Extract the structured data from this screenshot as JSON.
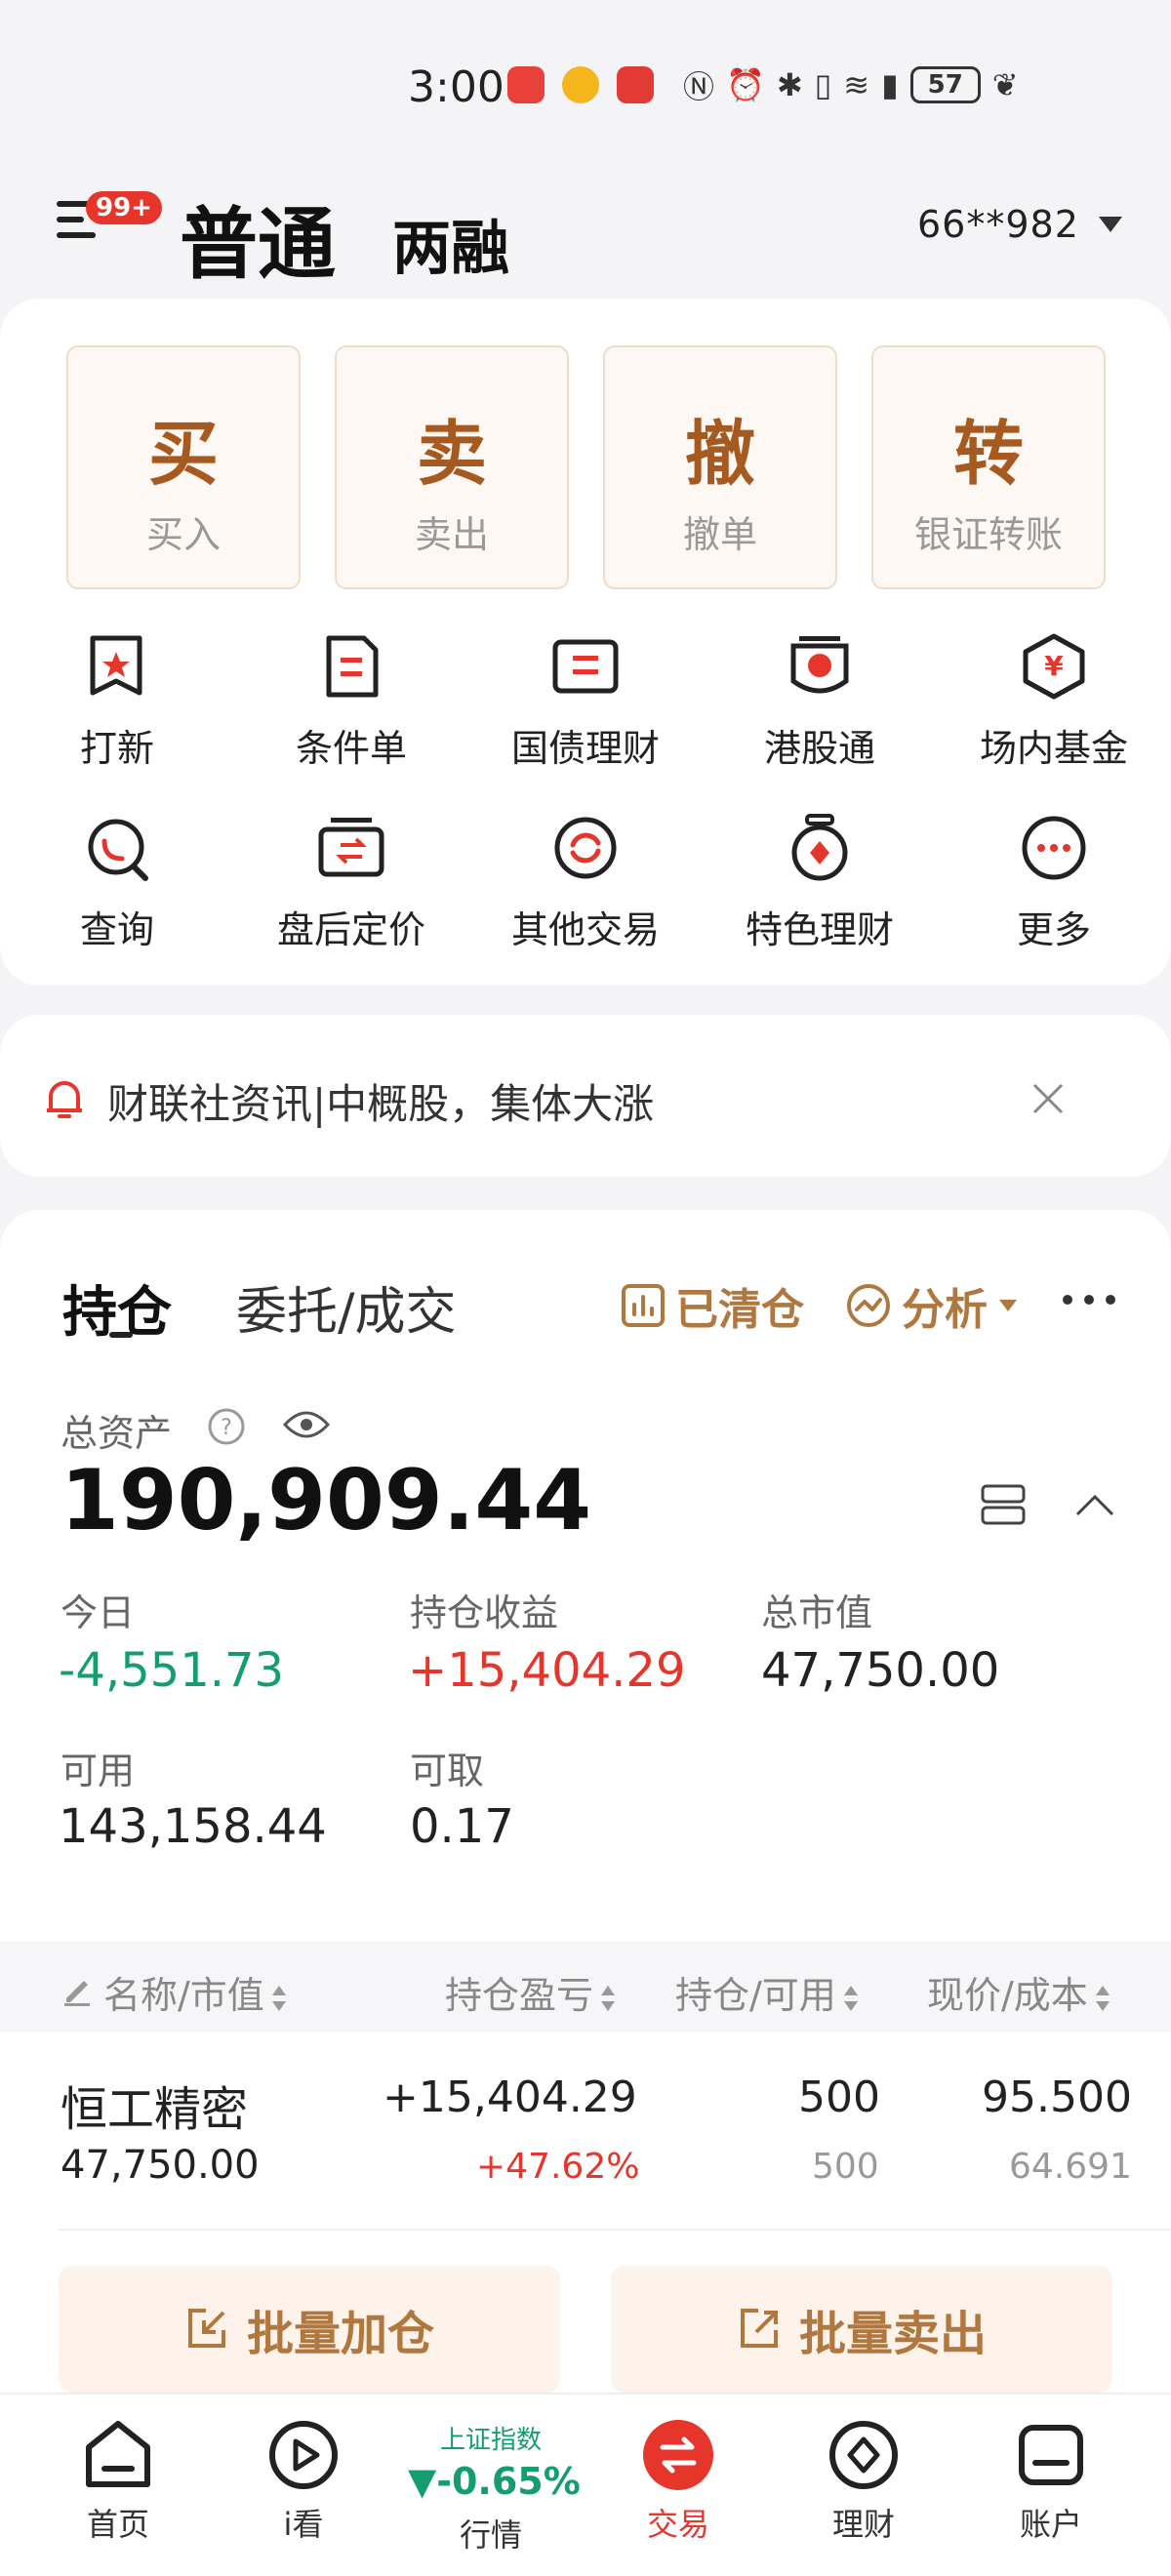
{
  "status_bar": {
    "time": "3:00",
    "battery": "57"
  },
  "header": {
    "badge": "99+",
    "tab_normal": "普通",
    "tab_margin": "两融",
    "account": "66**982"
  },
  "quick_actions": [
    {
      "main": "买",
      "sub": "买入"
    },
    {
      "main": "卖",
      "sub": "卖出"
    },
    {
      "main": "撤",
      "sub": "撤单"
    },
    {
      "main": "转",
      "sub": "银证转账"
    }
  ],
  "features": [
    {
      "label": "打新",
      "icon": "new-share-icon"
    },
    {
      "label": "条件单",
      "icon": "condition-order-icon"
    },
    {
      "label": "国债理财",
      "icon": "treasury-icon"
    },
    {
      "label": "港股通",
      "icon": "hk-connect-icon"
    },
    {
      "label": "场内基金",
      "icon": "fund-icon"
    },
    {
      "label": "查询",
      "icon": "query-icon"
    },
    {
      "label": "盘后定价",
      "icon": "after-hours-icon"
    },
    {
      "label": "其他交易",
      "icon": "other-trade-icon"
    },
    {
      "label": "特色理财",
      "icon": "wealth-icon"
    },
    {
      "label": "更多",
      "icon": "more-icon"
    }
  ],
  "notice": {
    "text": "财联社资讯|中概股，集体大涨"
  },
  "holdings": {
    "tab_position": "持仓",
    "tab_orders": "委托/成交",
    "cleared": "已清仓",
    "analysis": "分析",
    "total_label": "总资产",
    "total_value": "190,909.44",
    "today_label": "今日",
    "today_value": "-4,551.73",
    "profit_label": "持仓收益",
    "profit_value": "+15,404.29",
    "market_label": "总市值",
    "market_value": "47,750.00",
    "available_label": "可用",
    "available_value": "143,158.44",
    "withdrawable_label": "可取",
    "withdrawable_value": "0.17",
    "columns": [
      "名称/市值",
      "持仓盈亏",
      "持仓/可用",
      "现价/成本"
    ],
    "rows": [
      {
        "name": "恒工精密",
        "market_value": "47,750.00",
        "pnl": "+15,404.29",
        "pnl_pct": "+47.62%",
        "position": "500",
        "available": "500",
        "price": "95.500",
        "cost": "64.691"
      }
    ],
    "batch_add": "批量加仓",
    "batch_sell": "批量卖出"
  },
  "bottom_nav": {
    "home": "首页",
    "watch": "i看",
    "index_name": "上证指数",
    "index_change": "▼-0.65%",
    "market": "行情",
    "trade": "交易",
    "wealth": "理财",
    "account": "账户"
  },
  "colors": {
    "accent": "#a65a20",
    "gold": "#b0773f",
    "red": "#e6352b",
    "green": "#149e6f"
  }
}
